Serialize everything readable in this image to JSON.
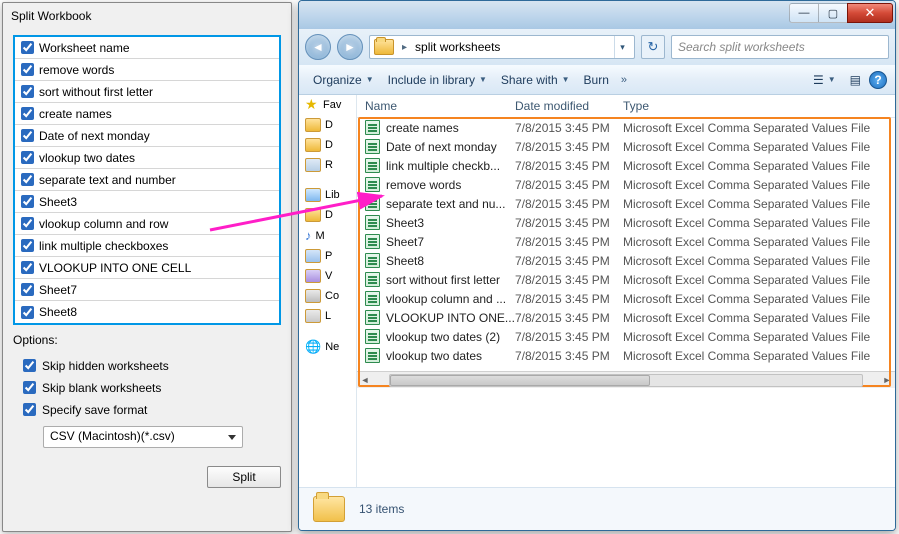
{
  "split_dialog": {
    "title": "Split Workbook",
    "header": "Worksheet name",
    "items": [
      "remove words",
      "sort without first letter",
      "create names",
      "Date of next monday",
      "vlookup two dates",
      "separate text and number",
      "Sheet3",
      "vlookup column and row",
      "link multiple checkboxes",
      "VLOOKUP INTO ONE CELL",
      "Sheet7",
      "Sheet8"
    ],
    "options_label": "Options:",
    "opt_skip_hidden": "Skip hidden worksheets",
    "opt_skip_blank": "Skip blank worksheets",
    "opt_save_format": "Specify save format",
    "format_value": "CSV (Macintosh)(*.csv)",
    "split_btn": "Split"
  },
  "explorer": {
    "path": "split worksheets",
    "search_placeholder": "Search split worksheets",
    "toolbar": {
      "organize": "Organize",
      "include": "Include in library",
      "share": "Share with",
      "burn": "Burn"
    },
    "columns": {
      "name": "Name",
      "date": "Date modified",
      "type": "Type"
    },
    "tree": [
      "Fav",
      "D",
      "D",
      "R",
      "Lib",
      "D",
      "M",
      "P",
      "V",
      "Co",
      "L",
      "Ne"
    ],
    "files": [
      {
        "name": "create names",
        "date": "7/8/2015 3:45 PM",
        "type": "Microsoft Excel Comma Separated Values File"
      },
      {
        "name": "Date of next monday",
        "date": "7/8/2015 3:45 PM",
        "type": "Microsoft Excel Comma Separated Values File"
      },
      {
        "name": "link multiple checkb...",
        "date": "7/8/2015 3:45 PM",
        "type": "Microsoft Excel Comma Separated Values File"
      },
      {
        "name": "remove words",
        "date": "7/8/2015 3:45 PM",
        "type": "Microsoft Excel Comma Separated Values File"
      },
      {
        "name": "separate text and nu...",
        "date": "7/8/2015 3:45 PM",
        "type": "Microsoft Excel Comma Separated Values File"
      },
      {
        "name": "Sheet3",
        "date": "7/8/2015 3:45 PM",
        "type": "Microsoft Excel Comma Separated Values File"
      },
      {
        "name": "Sheet7",
        "date": "7/8/2015 3:45 PM",
        "type": "Microsoft Excel Comma Separated Values File"
      },
      {
        "name": "Sheet8",
        "date": "7/8/2015 3:45 PM",
        "type": "Microsoft Excel Comma Separated Values File"
      },
      {
        "name": "sort without first letter",
        "date": "7/8/2015 3:45 PM",
        "type": "Microsoft Excel Comma Separated Values File"
      },
      {
        "name": "vlookup column and ...",
        "date": "7/8/2015 3:45 PM",
        "type": "Microsoft Excel Comma Separated Values File"
      },
      {
        "name": "VLOOKUP INTO ONE...",
        "date": "7/8/2015 3:45 PM",
        "type": "Microsoft Excel Comma Separated Values File"
      },
      {
        "name": "vlookup two dates (2)",
        "date": "7/8/2015 3:45 PM",
        "type": "Microsoft Excel Comma Separated Values File"
      },
      {
        "name": "vlookup two dates",
        "date": "7/8/2015 3:45 PM",
        "type": "Microsoft Excel Comma Separated Values File"
      }
    ],
    "status": "13 items"
  }
}
